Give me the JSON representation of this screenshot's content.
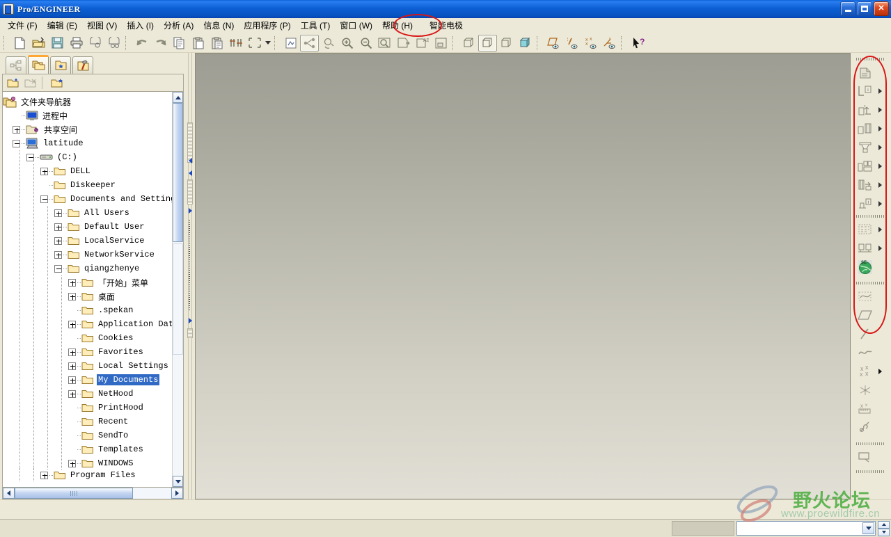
{
  "window": {
    "title": "Pro/ENGINEER",
    "icon": "proe-app-icon",
    "buttons": {
      "minimize": "minimize-button",
      "maximize": "maximize-button",
      "close": "close-button"
    }
  },
  "menubar": {
    "items": [
      {
        "label": "文件 (F)",
        "name": "menu-file"
      },
      {
        "label": "编辑 (E)",
        "name": "menu-edit"
      },
      {
        "label": "视图 (V)",
        "name": "menu-view"
      },
      {
        "label": "插入 (I)",
        "name": "menu-insert"
      },
      {
        "label": "分析 (A)",
        "name": "menu-analysis"
      },
      {
        "label": "信息 (N)",
        "name": "menu-info"
      },
      {
        "label": "应用程序 (P)",
        "name": "menu-applications"
      },
      {
        "label": "工具 (T)",
        "name": "menu-tools"
      },
      {
        "label": "窗口 (W)",
        "name": "menu-window"
      },
      {
        "label": "帮助 (H)",
        "name": "menu-help"
      },
      {
        "label": "智能电极",
        "name": "menu-smart-electrode",
        "highlighted": true
      }
    ],
    "highlight_color": "#d81616"
  },
  "toolbar": {
    "groups": [
      {
        "buttons": [
          {
            "name": "new-file-icon",
            "title": "新建"
          },
          {
            "name": "open-file-icon",
            "title": "打开"
          },
          {
            "name": "save-file-icon",
            "title": "保存"
          },
          {
            "name": "print-icon",
            "title": "打印"
          },
          {
            "name": "send-mail-icon",
            "title": "发送"
          },
          {
            "name": "send-mail-group-icon",
            "title": "发送至"
          }
        ]
      },
      {
        "buttons": [
          {
            "name": "undo-icon",
            "title": "撤消"
          },
          {
            "name": "redo-icon",
            "title": "重做"
          },
          {
            "name": "copy-icon",
            "title": "复制"
          },
          {
            "name": "paste-icon",
            "title": "粘贴"
          },
          {
            "name": "paste-special-icon",
            "title": "选择性粘贴"
          },
          {
            "name": "regenerate-icon",
            "title": "重新生成"
          },
          {
            "name": "select-box-icon",
            "title": "选取"
          }
        ],
        "dropdown": true
      },
      {
        "buttons": [
          {
            "name": "repaint-icon",
            "title": "重画"
          },
          {
            "name": "spin-center-icon",
            "title": "旋转中心",
            "active": true
          },
          {
            "name": "reorient-icon",
            "title": "重定向"
          },
          {
            "name": "zoom-in-icon",
            "title": "放大"
          },
          {
            "name": "zoom-out-icon",
            "title": "缩小"
          },
          {
            "name": "refit-icon",
            "title": "重新调整"
          },
          {
            "name": "saved-view-icon",
            "title": "已保存视图"
          },
          {
            "name": "annotation-view-icon",
            "title": "注释视图"
          },
          {
            "name": "layer-icon",
            "title": "层"
          }
        ]
      },
      {
        "buttons": [
          {
            "name": "display-wireframe-icon",
            "title": "线框"
          },
          {
            "name": "display-hidden-line-icon",
            "title": "隐藏线",
            "active": true
          },
          {
            "name": "display-no-hidden-icon",
            "title": "无隐藏线"
          },
          {
            "name": "display-shaded-icon",
            "title": "着色"
          }
        ]
      },
      {
        "buttons": [
          {
            "name": "datum-plane-display-icon",
            "title": "基准平面显示"
          },
          {
            "name": "datum-axis-display-icon",
            "title": "基准轴显示"
          },
          {
            "name": "datum-point-display-icon",
            "title": "基准点显示"
          },
          {
            "name": "datum-csys-display-icon",
            "title": "坐标系显示"
          }
        ]
      },
      {
        "buttons": [
          {
            "name": "context-help-icon",
            "title": "上下文帮助"
          }
        ]
      }
    ]
  },
  "navigator": {
    "tabs": [
      {
        "name": "tab-model-tree",
        "icon": "model-tree-icon",
        "selected": false
      },
      {
        "name": "tab-folder-browser",
        "icon": "folder-browser-icon",
        "selected": true
      },
      {
        "name": "tab-favorites",
        "icon": "favorites-folder-icon",
        "selected": false
      },
      {
        "name": "tab-connections",
        "icon": "connections-hammer-icon",
        "selected": false
      }
    ],
    "toolbar": [
      {
        "name": "new-folder-icon"
      },
      {
        "name": "cut-folder-icon"
      },
      {
        "name": "add-favorite-icon"
      }
    ],
    "root_label": "文件夹导航器",
    "root_icon": "folder-navigator-icon",
    "tree": [
      {
        "label": "进程中",
        "depth": 1,
        "icon": "in-session-icon",
        "expander": "none",
        "cjk": true
      },
      {
        "label": "共享空间",
        "depth": 1,
        "icon": "shared-space-icon",
        "expander": "plus",
        "cjk": true
      },
      {
        "label": "latitude",
        "depth": 1,
        "icon": "computer-icon",
        "expander": "minus"
      },
      {
        "label": "(C:)",
        "depth": 2,
        "icon": "drive-icon",
        "expander": "minus"
      },
      {
        "label": "DELL",
        "depth": 3,
        "icon": "folder-icon",
        "expander": "plus"
      },
      {
        "label": "Diskeeper",
        "depth": 3,
        "icon": "folder-icon",
        "expander": "none"
      },
      {
        "label": "Documents and Settings",
        "depth": 3,
        "icon": "folder-icon",
        "expander": "minus"
      },
      {
        "label": "All Users",
        "depth": 4,
        "icon": "folder-icon",
        "expander": "plus"
      },
      {
        "label": "Default User",
        "depth": 4,
        "icon": "folder-icon",
        "expander": "plus"
      },
      {
        "label": "LocalService",
        "depth": 4,
        "icon": "folder-icon",
        "expander": "plus"
      },
      {
        "label": "NetworkService",
        "depth": 4,
        "icon": "folder-icon",
        "expander": "plus"
      },
      {
        "label": "qiangzhenye",
        "depth": 4,
        "icon": "folder-icon",
        "expander": "minus"
      },
      {
        "label": "「开始」菜单",
        "depth": 5,
        "icon": "folder-icon",
        "expander": "plus",
        "cjk": true
      },
      {
        "label": "桌面",
        "depth": 5,
        "icon": "folder-icon",
        "expander": "plus",
        "cjk": true
      },
      {
        "label": ".spekan",
        "depth": 5,
        "icon": "folder-icon",
        "expander": "none"
      },
      {
        "label": "Application Data",
        "depth": 5,
        "icon": "folder-icon",
        "expander": "plus"
      },
      {
        "label": "Cookies",
        "depth": 5,
        "icon": "folder-icon",
        "expander": "none"
      },
      {
        "label": "Favorites",
        "depth": 5,
        "icon": "folder-icon",
        "expander": "plus"
      },
      {
        "label": "Local Settings",
        "depth": 5,
        "icon": "folder-icon",
        "expander": "plus"
      },
      {
        "label": "My Documents",
        "depth": 5,
        "icon": "folder-icon",
        "expander": "plus",
        "selected": true
      },
      {
        "label": "NetHood",
        "depth": 5,
        "icon": "folder-icon",
        "expander": "plus"
      },
      {
        "label": "PrintHood",
        "depth": 5,
        "icon": "folder-icon",
        "expander": "none"
      },
      {
        "label": "Recent",
        "depth": 5,
        "icon": "folder-icon",
        "expander": "none"
      },
      {
        "label": "SendTo",
        "depth": 5,
        "icon": "folder-icon",
        "expander": "none"
      },
      {
        "label": "Templates",
        "depth": 5,
        "icon": "folder-icon",
        "expander": "none"
      },
      {
        "label": "WINDOWS",
        "depth": 5,
        "icon": "folder-icon",
        "expander": "plus"
      },
      {
        "label": "Program Files",
        "depth": 3,
        "icon": "folder-icon",
        "expander": "plus",
        "clipped": true
      }
    ],
    "selection_color": "#316ac5"
  },
  "canvas": {
    "gradient_top": "#9d9d93",
    "gradient_bottom": "#e2e0d6"
  },
  "right_toolbar": {
    "highlight_color": "#d81616",
    "electrode_group": [
      {
        "name": "electrode-workpiece-icon",
        "flyout": false
      },
      {
        "name": "electrode-info-icon",
        "flyout": true
      },
      {
        "name": "electrode-csys-icon",
        "flyout": true
      },
      {
        "name": "electrode-blank-icon",
        "flyout": true
      },
      {
        "name": "electrode-holder-icon",
        "flyout": true
      },
      {
        "name": "electrode-assembly-icon",
        "flyout": true
      },
      {
        "name": "electrode-position-icon",
        "flyout": true
      },
      {
        "name": "electrode-param-icon",
        "flyout": true
      },
      {
        "name": "electrode-pattern-icon",
        "flyout": true
      },
      {
        "name": "electrode-report-icon",
        "flyout": true
      },
      {
        "name": "electrode-globe-icon",
        "flyout": false
      }
    ],
    "datum_group": [
      {
        "name": "datum-curve-icon",
        "flyout": false
      },
      {
        "name": "datum-plane-icon",
        "flyout": false
      },
      {
        "name": "datum-axis-icon",
        "flyout": false
      },
      {
        "name": "datum-curve-sketch-icon",
        "flyout": false
      },
      {
        "name": "datum-point-icon",
        "flyout": true
      },
      {
        "name": "datum-point-offset-icon",
        "flyout": false
      },
      {
        "name": "datum-coord-sys-icon",
        "flyout": false
      },
      {
        "name": "datum-analysis-icon",
        "flyout": false
      }
    ],
    "misc_group": [
      {
        "name": "datum-evaluate-icon",
        "flyout": false
      }
    ]
  },
  "statusbar": {
    "message": "",
    "combo_value": "",
    "combo_name": "status-combo"
  },
  "watermark": {
    "title": "野火论坛",
    "url": "www.proewildfire.cn",
    "title_color": "#56b14a",
    "url_color": "#9fc9a8"
  }
}
